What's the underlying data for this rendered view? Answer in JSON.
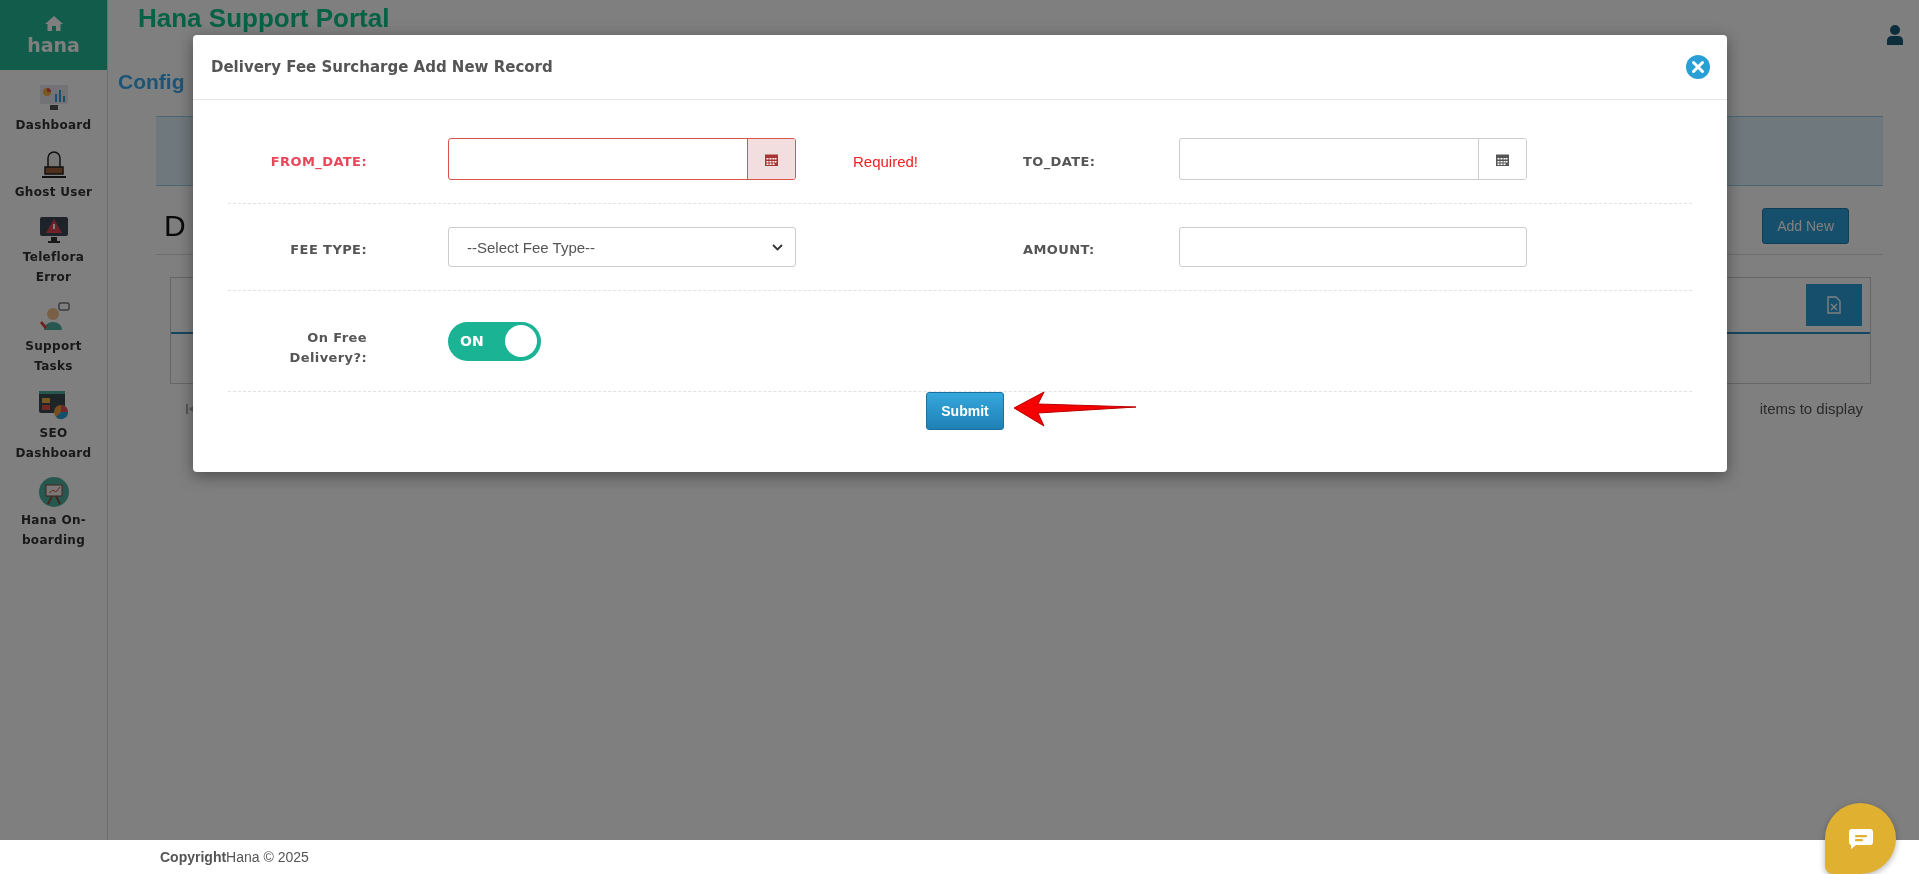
{
  "sidebar": {
    "logo": "hana",
    "items": [
      {
        "label": "Dashboard"
      },
      {
        "label": "Ghost User"
      },
      {
        "label": "Teleflora Error"
      },
      {
        "label": "Support Tasks"
      },
      {
        "label": "SEO Dashboard"
      },
      {
        "label": "Hana On-boarding"
      }
    ]
  },
  "header": {
    "title": "Hana Support Portal"
  },
  "page": {
    "breadcrumb": "Config",
    "heading": "D",
    "add_button": "Add New",
    "pager_text": "items to display"
  },
  "modal": {
    "title": "Delivery Fee Surcharge Add New Record",
    "fields": [
      {
        "kind": "date",
        "label": "FROM_DATE:",
        "invalid": true,
        "error": "Required!"
      },
      {
        "kind": "date",
        "label": "TO_DATE:",
        "invalid": false
      },
      {
        "kind": "select",
        "label": "FEE TYPE:",
        "placeholder": "--Select Fee Type--"
      },
      {
        "kind": "text",
        "label": "AMOUNT:"
      },
      {
        "kind": "toggle",
        "label": "On Free Delivery?:",
        "on": true,
        "on_text": "ON"
      }
    ],
    "submit": "Submit"
  },
  "footer": {
    "text": "**Copyright**Hana © 2025"
  }
}
